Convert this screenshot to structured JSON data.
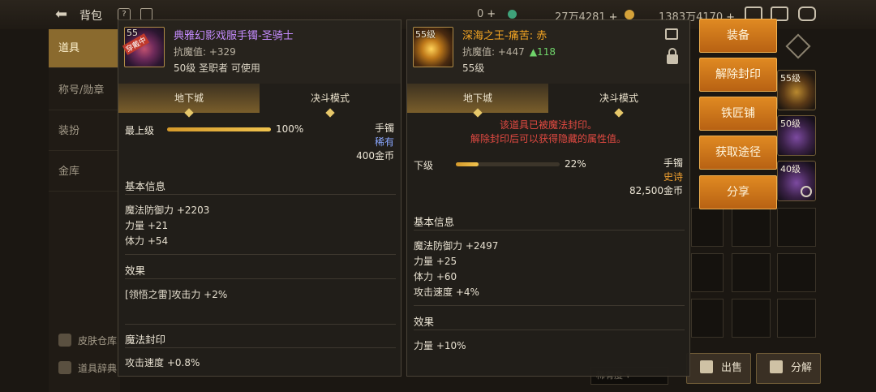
{
  "topbar": {
    "title": "背包",
    "currency1": "0",
    "currency2": "27万4281",
    "currency3": "1383万4170"
  },
  "sidebar": {
    "items": [
      "道具",
      "称号/勋章",
      "装扮",
      "金库"
    ],
    "bottom_links": [
      "皮肤仓库",
      "道具辞典"
    ]
  },
  "inventory": {
    "thumbs": [
      {
        "level": "55级"
      },
      {
        "level": "50级"
      },
      {
        "level": "40级"
      }
    ],
    "sell_label": "出售",
    "decompose_label": "分解",
    "sort_label": "稀有度"
  },
  "left_item": {
    "level_badge": "55",
    "tag": "穿戴中",
    "name": "典雅幻影戏服手镯-圣骑士",
    "resist": "抗魔值: +329",
    "meta": "50级 圣职者 可使用",
    "tab_dungeon": "地下城",
    "tab_duel": "决斗模式",
    "grade_label": "最上级",
    "grade_pct_value": 100,
    "grade_pct": "100%",
    "type": "手镯",
    "rarity": "稀有",
    "price": "400金币",
    "basic_info_title": "基本信息",
    "stats": [
      "魔法防御力 +2203",
      "力量 +21",
      "体力 +54"
    ],
    "effect_title": "效果",
    "effects": [
      "[领悟之雷]攻击力 +2%"
    ],
    "seal_title": "魔法封印",
    "seal_stats": [
      "攻击速度 +0.8%"
    ]
  },
  "right_item": {
    "level_badge": "55级",
    "name": "深海之王-痛苦: 赤",
    "resist": "抗魔值: +447",
    "resist_diff": "▲118",
    "meta": "55级",
    "tab_dungeon": "地下城",
    "tab_duel": "决斗模式",
    "seal_warning_1": "该道具已被魔法封印。",
    "seal_warning_2": "解除封印后可以获得隐藏的属性值。",
    "grade_label": "下级",
    "grade_pct_value": 22,
    "grade_pct": "22%",
    "type": "手镯",
    "rarity": "史诗",
    "price": "82,500金币",
    "basic_info_title": "基本信息",
    "stats": [
      "魔法防御力 +2497",
      "力量 +25",
      "体力 +60",
      "攻击速度 +4%"
    ],
    "effect_title": "效果",
    "effects": [
      "力量 +10%"
    ]
  },
  "actions": [
    "装备",
    "解除封印",
    "铁匠铺",
    "获取途径",
    "分享"
  ],
  "colors": {
    "left_name": "#c58cff",
    "right_name": "#f5a623",
    "accent": "#d9862a"
  }
}
